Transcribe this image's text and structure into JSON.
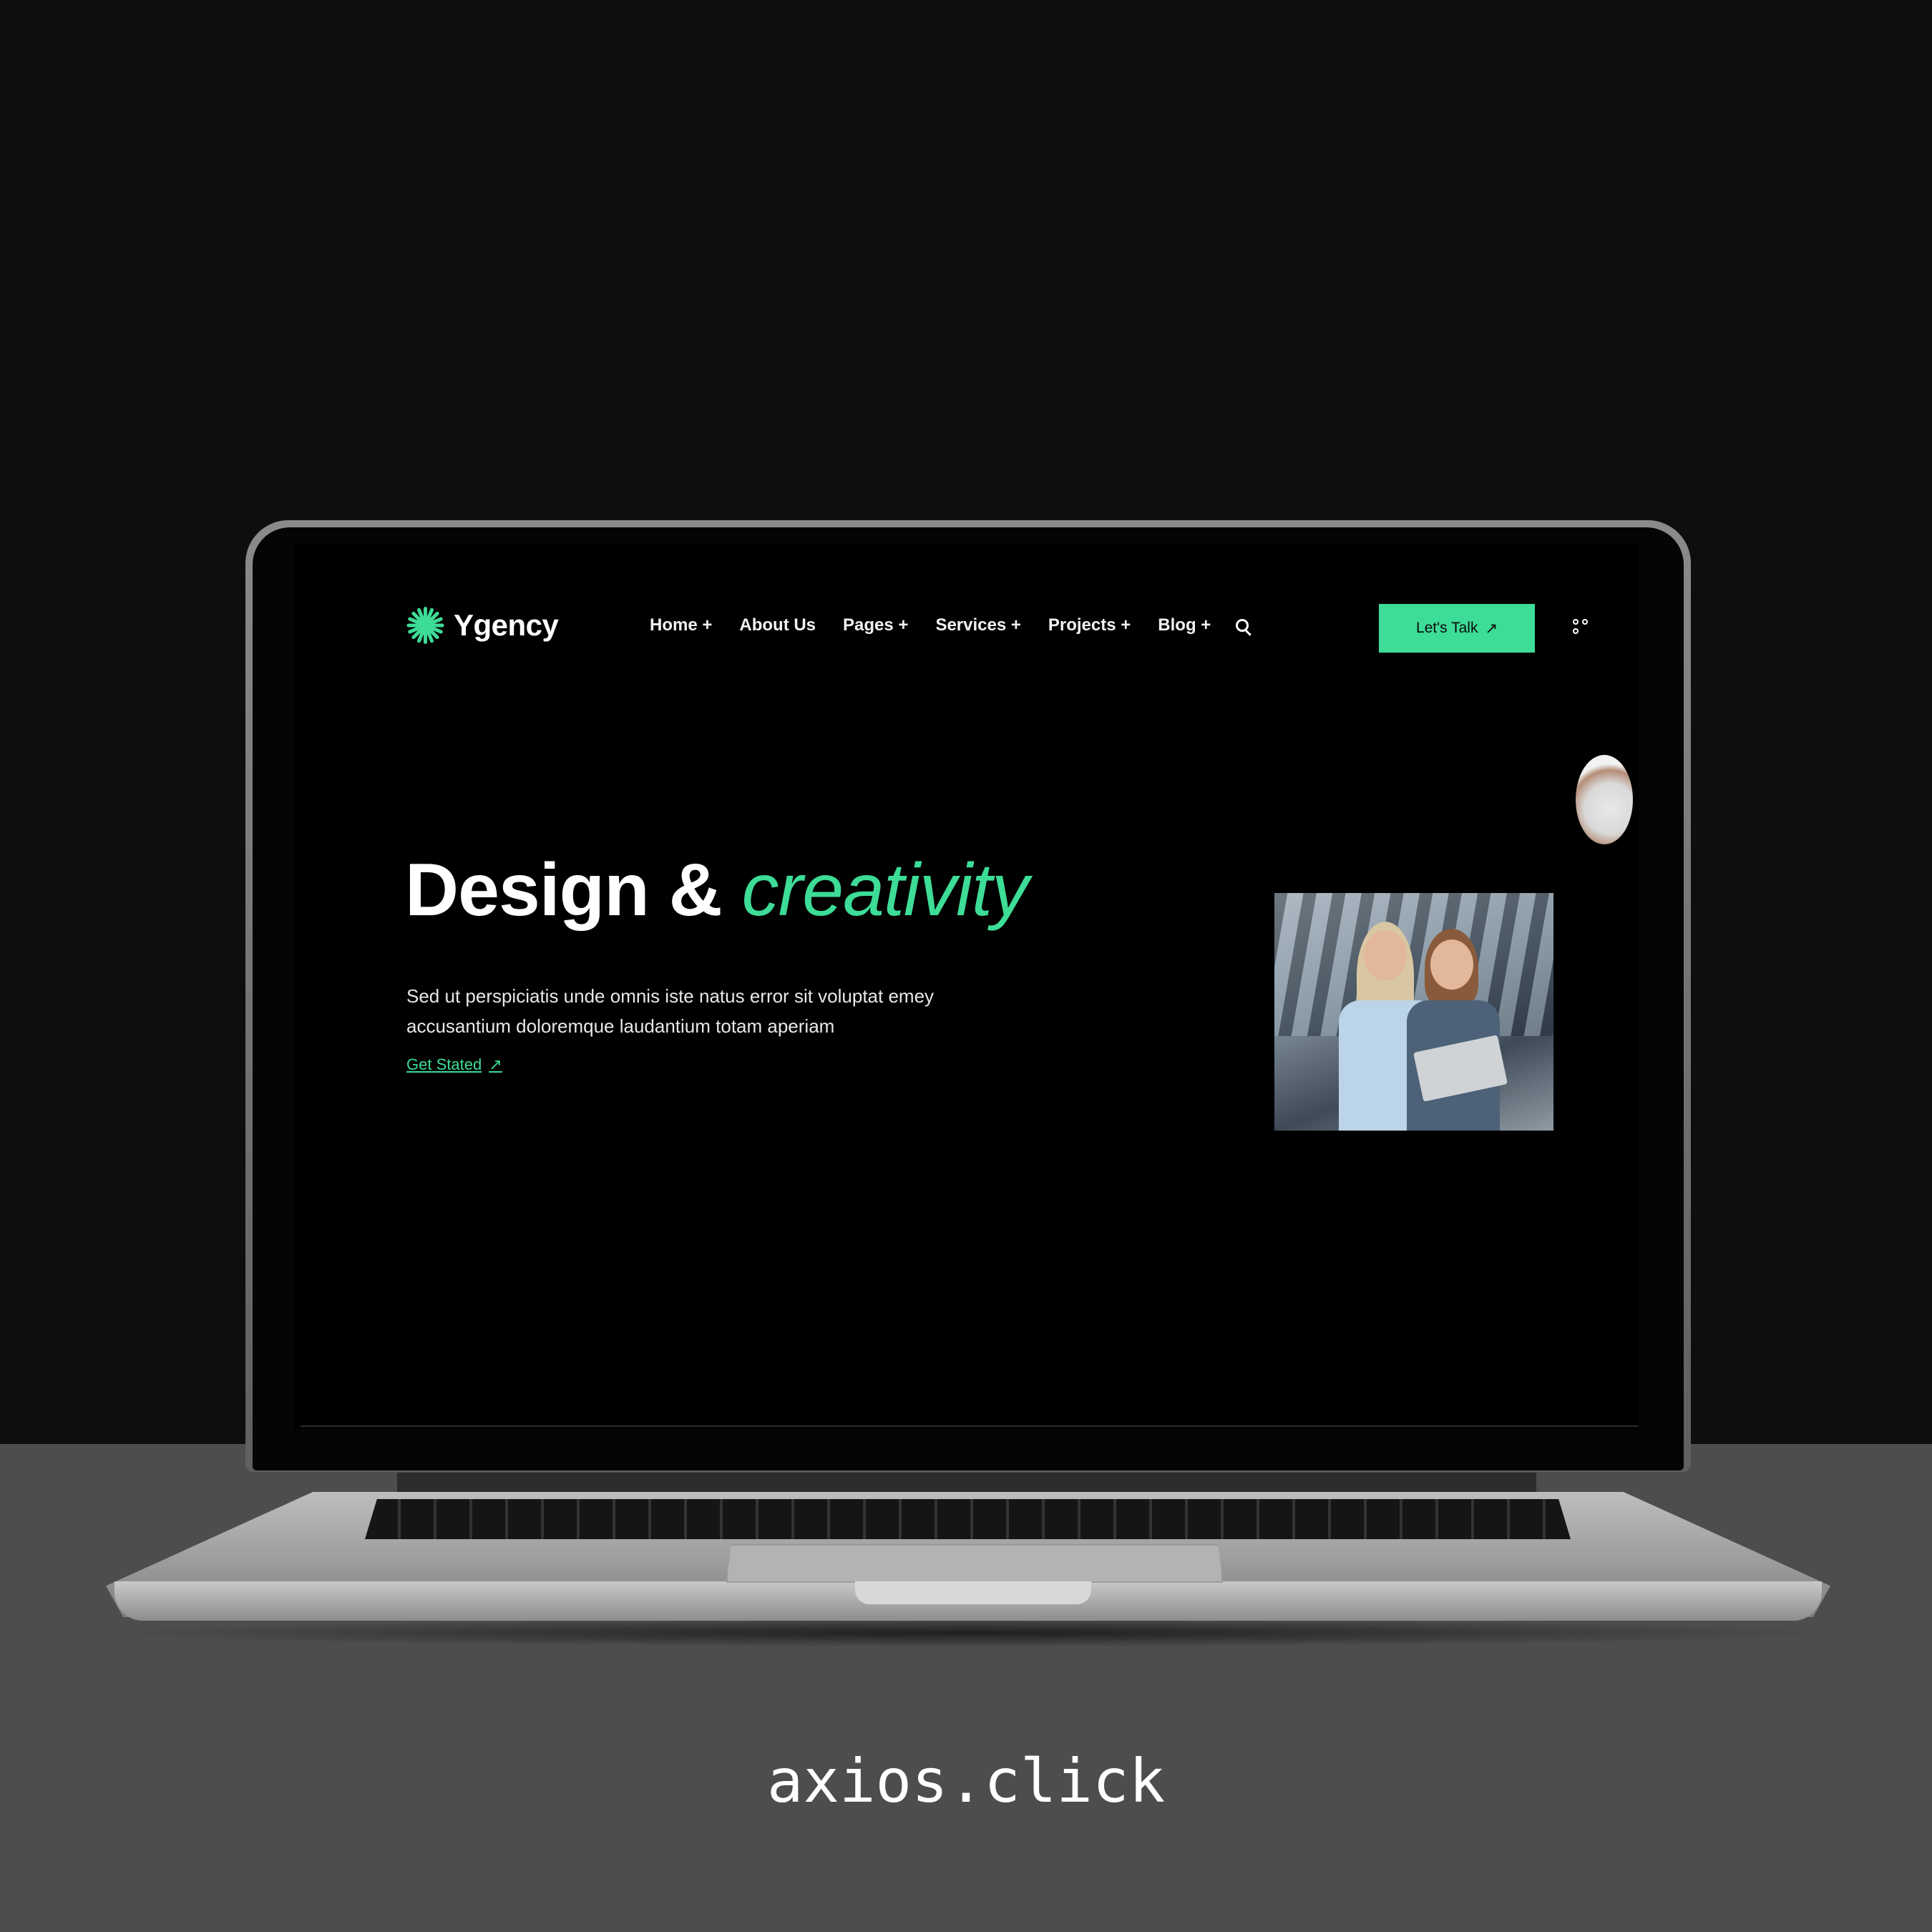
{
  "brand": {
    "name": "Ygency",
    "accent": "#3ddc97"
  },
  "nav": {
    "items": [
      "Home +",
      "About Us",
      "Pages +",
      "Services +",
      "Projects +",
      "Blog +"
    ],
    "search_icon": "search-icon",
    "cta_label": "Let's Talk",
    "cta_icon": "↗",
    "menu_icon": "grid-icon"
  },
  "hero": {
    "title_main": "Design & ",
    "title_accent": "creativity",
    "description": "Sed ut perspiciatis unde omnis iste natus error sit voluptat emey accusantium doloremque laudantium totam aperiam",
    "link_label": "Get Stated",
    "link_icon": "↗"
  },
  "watermark": "axios.click"
}
